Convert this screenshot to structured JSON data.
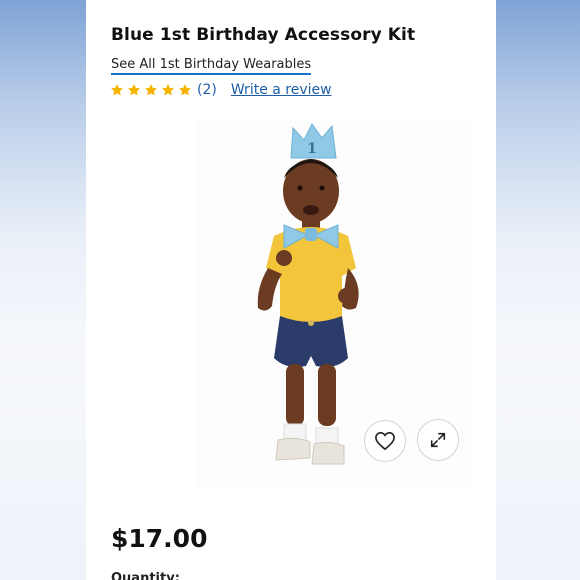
{
  "product": {
    "title": "Blue 1st Birthday Accessory Kit",
    "category_link": "See All 1st Birthday Wearables",
    "rating": {
      "stars": 5,
      "count_label": "(2)",
      "write_review_label": "Write a review",
      "star_color": "#f5b400"
    },
    "image": {
      "hat_number": "1"
    },
    "price": "$17.00",
    "quantity_label": "Quantity:"
  },
  "icons": {
    "wishlist": "heart-icon",
    "expand": "expand-icon"
  },
  "colors": {
    "link_underline": "#1a73c9",
    "link_text": "#1f5ea8"
  }
}
